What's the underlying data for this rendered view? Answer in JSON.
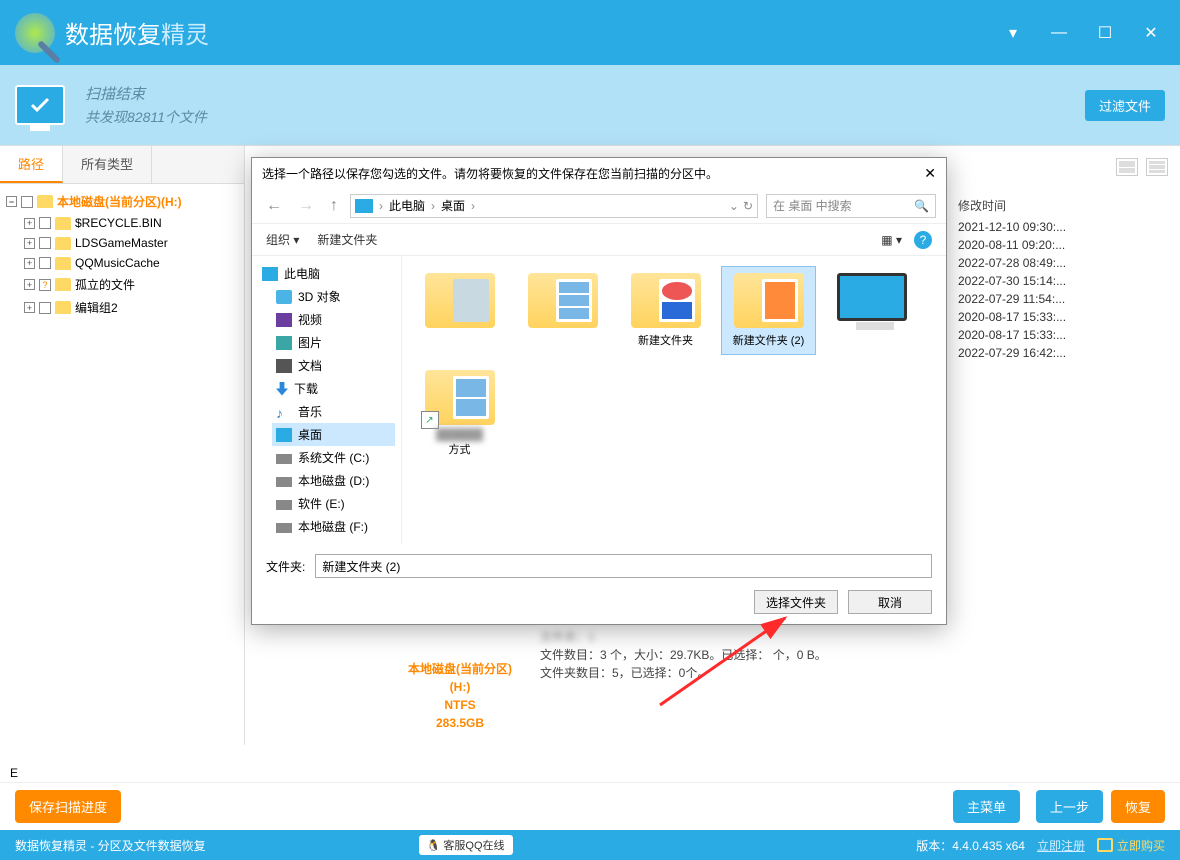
{
  "app": {
    "title_main": "数据恢复",
    "title_light": "精灵"
  },
  "title_buttons": {
    "dropdown": "▾",
    "min": "—",
    "max": "☐",
    "close": "✕"
  },
  "status": {
    "title": "扫描结束",
    "sub": "共发现82811个文件",
    "filter_btn": "过滤文件"
  },
  "tabs": {
    "path": "路径",
    "all_types": "所有类型"
  },
  "tree": {
    "root": "本地磁盘(当前分区)(H:)",
    "items": [
      "$RECYCLE.BIN",
      "LDSGameMaster",
      "QQMusicCache",
      "孤立的文件",
      "编辑组2"
    ]
  },
  "dates": {
    "header": "修改时间",
    "rows": [
      "2021-12-10 09:30:...",
      "2020-08-11 09:20:...",
      "2022-07-28 08:49:...",
      "2022-07-30 15:14:...",
      "2022-07-29 11:54:...",
      "2020-08-17 15:33:...",
      "2020-08-17 15:33:...",
      "2022-07-29 16:42:..."
    ]
  },
  "disk_card": {
    "l1": "本地磁盘(当前分区)(H:)",
    "l2": "NTFS",
    "l3": "283.5GB"
  },
  "meta": {
    "l0": "文件夹：1",
    "l1": "文件数目：3 个，大小：29.7KB。已选择：   个，0 B。",
    "l2": "文件夹数目：5，已选择：0个。"
  },
  "bottom": {
    "save_scan": "保存扫描进度",
    "main_menu": "主菜单",
    "prev": "上一步",
    "recover": "恢复"
  },
  "footer": {
    "left": "数据恢复精灵 - 分区及文件数据恢复",
    "qq": "客服QQ在线",
    "version": "版本：4.4.0.435 x64",
    "register": "立即注册",
    "buy": "立即购买"
  },
  "dialog": {
    "title": "选择一个路径以保存您勾选的文件。请勿将要恢复的文件保存在您当前扫描的分区中。",
    "breadcrumb": {
      "a": "此电脑",
      "b": "桌面"
    },
    "search_placeholder": "在 桌面 中搜索",
    "organize": "组织",
    "newfolder": "新建文件夹",
    "tree": {
      "pc": "此电脑",
      "obj3d": "3D 对象",
      "video": "视频",
      "pic": "图片",
      "doc": "文档",
      "dl": "下载",
      "music": "音乐",
      "desktop": "桌面",
      "sysC": "系统文件 (C:)",
      "localD": "本地磁盘 (D:)",
      "softE": "软件 (E:)",
      "localF": "本地磁盘 (F:)"
    },
    "files": {
      "f1": "",
      "f2": "",
      "f3": "新建文件夹",
      "f4": "新建文件夹 (2)",
      "f5": "",
      "f6_l1": "",
      "f6_l2": "方式"
    },
    "folder_label": "文件夹:",
    "folder_value": "新建文件夹 (2)",
    "select_btn": "选择文件夹",
    "cancel_btn": "取消"
  },
  "misc": {
    "e": "E"
  }
}
